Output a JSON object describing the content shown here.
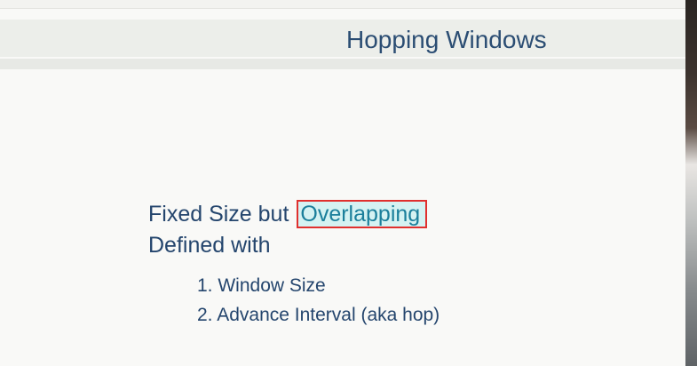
{
  "slide": {
    "title": "Hopping Windows",
    "line1_prefix": "Fixed Size but",
    "line1_highlight": "Overlapping",
    "line2": "Defined with",
    "items": [
      {
        "number": "1.",
        "text": "Window Size"
      },
      {
        "number": "2.",
        "text": "Advance Interval (aka hop)"
      }
    ]
  },
  "colors": {
    "text": "#24456d",
    "highlight_text": "#1b7f9b",
    "highlight_bg": "#d5f2f2",
    "highlight_border": "#e0302e"
  }
}
